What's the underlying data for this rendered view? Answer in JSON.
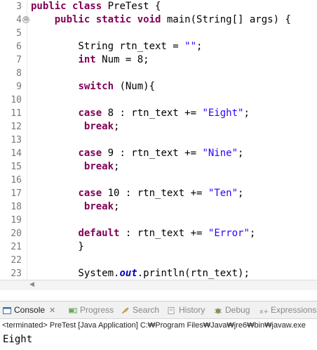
{
  "editor": {
    "lines": [
      {
        "num": "3",
        "fold": "",
        "tokens": [
          {
            "t": "kw",
            "v": "public class"
          },
          {
            "t": "plain",
            "v": " PreTest {"
          }
        ]
      },
      {
        "num": "4",
        "fold": "⊖",
        "tokens": [
          {
            "t": "plain",
            "v": "    "
          },
          {
            "t": "kw",
            "v": "public static void"
          },
          {
            "t": "plain",
            "v": " main(String[] args) {"
          }
        ]
      },
      {
        "num": "5",
        "fold": "",
        "tokens": []
      },
      {
        "num": "6",
        "fold": "",
        "tokens": [
          {
            "t": "plain",
            "v": "        String rtn_text = "
          },
          {
            "t": "str",
            "v": "\"\""
          },
          {
            "t": "plain",
            "v": ";"
          }
        ]
      },
      {
        "num": "7",
        "fold": "",
        "tokens": [
          {
            "t": "plain",
            "v": "        "
          },
          {
            "t": "kw",
            "v": "int"
          },
          {
            "t": "plain",
            "v": " Num = 8;"
          }
        ]
      },
      {
        "num": "8",
        "fold": "",
        "tokens": []
      },
      {
        "num": "9",
        "fold": "",
        "tokens": [
          {
            "t": "plain",
            "v": "        "
          },
          {
            "t": "kw",
            "v": "switch"
          },
          {
            "t": "plain",
            "v": " (Num){"
          }
        ]
      },
      {
        "num": "10",
        "fold": "",
        "tokens": []
      },
      {
        "num": "11",
        "fold": "",
        "tokens": [
          {
            "t": "plain",
            "v": "        "
          },
          {
            "t": "kw",
            "v": "case"
          },
          {
            "t": "plain",
            "v": " 8 : rtn_text += "
          },
          {
            "t": "str",
            "v": "\"Eight\""
          },
          {
            "t": "plain",
            "v": ";"
          }
        ]
      },
      {
        "num": "12",
        "fold": "",
        "tokens": [
          {
            "t": "plain",
            "v": "         "
          },
          {
            "t": "kw",
            "v": "break"
          },
          {
            "t": "plain",
            "v": ";"
          }
        ]
      },
      {
        "num": "13",
        "fold": "",
        "tokens": []
      },
      {
        "num": "14",
        "fold": "",
        "tokens": [
          {
            "t": "plain",
            "v": "        "
          },
          {
            "t": "kw",
            "v": "case"
          },
          {
            "t": "plain",
            "v": " 9 : rtn_text += "
          },
          {
            "t": "str",
            "v": "\"Nine\""
          },
          {
            "t": "plain",
            "v": ";"
          }
        ]
      },
      {
        "num": "15",
        "fold": "",
        "tokens": [
          {
            "t": "plain",
            "v": "         "
          },
          {
            "t": "kw",
            "v": "break"
          },
          {
            "t": "plain",
            "v": ";"
          }
        ]
      },
      {
        "num": "16",
        "fold": "",
        "tokens": []
      },
      {
        "num": "17",
        "fold": "",
        "tokens": [
          {
            "t": "plain",
            "v": "        "
          },
          {
            "t": "kw",
            "v": "case"
          },
          {
            "t": "plain",
            "v": " 10 : rtn_text += "
          },
          {
            "t": "str",
            "v": "\"Ten\""
          },
          {
            "t": "plain",
            "v": ";"
          }
        ]
      },
      {
        "num": "18",
        "fold": "",
        "tokens": [
          {
            "t": "plain",
            "v": "         "
          },
          {
            "t": "kw",
            "v": "break"
          },
          {
            "t": "plain",
            "v": ";"
          }
        ]
      },
      {
        "num": "19",
        "fold": "",
        "tokens": []
      },
      {
        "num": "20",
        "fold": "",
        "tokens": [
          {
            "t": "plain",
            "v": "        "
          },
          {
            "t": "kw",
            "v": "default"
          },
          {
            "t": "plain",
            "v": " : rtn_text += "
          },
          {
            "t": "str",
            "v": "\"Error\""
          },
          {
            "t": "plain",
            "v": ";"
          }
        ]
      },
      {
        "num": "21",
        "fold": "",
        "tokens": [
          {
            "t": "plain",
            "v": "        }"
          }
        ]
      },
      {
        "num": "22",
        "fold": "",
        "tokens": []
      },
      {
        "num": "23",
        "fold": "",
        "tokens": [
          {
            "t": "plain",
            "v": "        System."
          },
          {
            "t": "fld",
            "v": "out"
          },
          {
            "t": "plain",
            "v": ".println(rtn_text);"
          }
        ]
      }
    ]
  },
  "console": {
    "tabs": [
      {
        "label": "Console",
        "icon": "console-icon",
        "active": true,
        "closable": true
      },
      {
        "label": "Progress",
        "icon": "progress-icon",
        "active": false
      },
      {
        "label": "Search",
        "icon": "search-icon",
        "active": false
      },
      {
        "label": "History",
        "icon": "history-icon",
        "active": false
      },
      {
        "label": "Debug",
        "icon": "debug-icon",
        "active": false
      },
      {
        "label": "Expressions",
        "icon": "expressions-icon",
        "active": false
      }
    ],
    "status": "<terminated> PreTest [Java Application] C:₩Program Files₩Java₩jre6₩bin₩javaw.exe",
    "output": "Eight"
  },
  "colors": {
    "keyword": "#7f0055",
    "string": "#2a00ff",
    "field": "#0000c0",
    "line_number": "#787878"
  }
}
